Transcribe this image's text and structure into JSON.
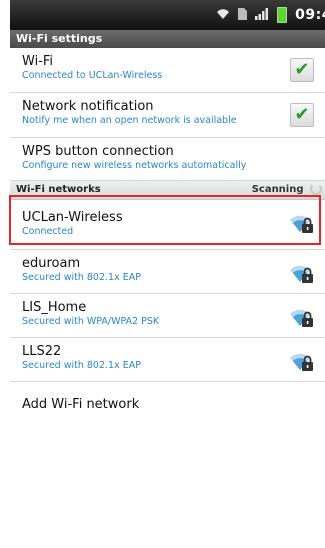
{
  "status": {
    "time": "09:4",
    "icons": [
      "wifi-icon",
      "sim-icon",
      "signal-icon",
      "battery-icon"
    ]
  },
  "title": "Wi-Fi settings",
  "settings": [
    {
      "title": "Wi-Fi",
      "subtitle": "Connected to UCLan-Wireless",
      "checked": true
    },
    {
      "title": "Network notification",
      "subtitle": "Notify me when an open network is available",
      "checked": true
    },
    {
      "title": "WPS button connection",
      "subtitle": "Configure new wireless networks automatically"
    }
  ],
  "networks_header": {
    "label": "Wi-Fi networks",
    "status": "Scanning"
  },
  "networks": [
    {
      "name": "UCLan-Wireless",
      "status": "Connected",
      "icon": "wifi-lock-icon"
    },
    {
      "name": "eduroam",
      "status": "Secured with 802.1x EAP",
      "icon": "wifi-lock-icon"
    },
    {
      "name": "LIS_Home",
      "status": "Secured with WPA/WPA2 PSK",
      "icon": "wifi-lock-icon"
    },
    {
      "name": "LLS22",
      "status": "Secured with 802.1x EAP",
      "icon": "wifi-lock-icon"
    }
  ],
  "add_network": "Add Wi-Fi network",
  "colors": {
    "accent": "#2a86c9",
    "highlight": "#e5262a",
    "check": "#2b9b2b"
  }
}
